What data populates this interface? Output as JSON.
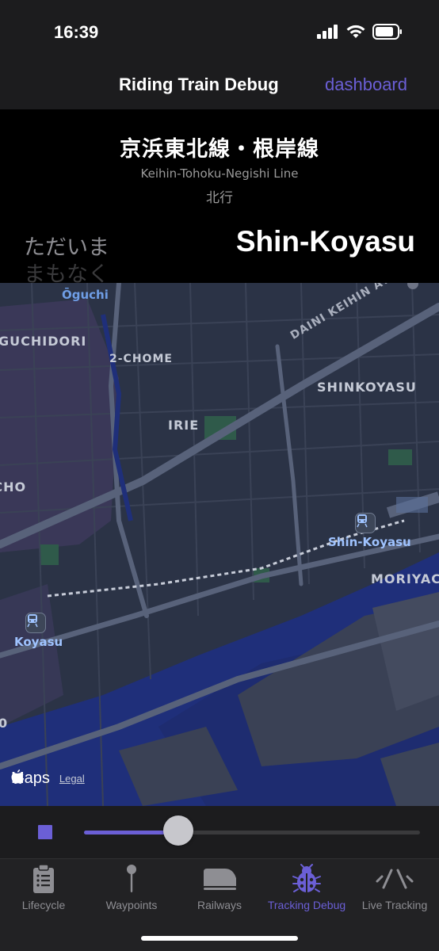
{
  "status_bar": {
    "time": "16:39",
    "icons": [
      "signal-icon",
      "wifi-icon",
      "battery-icon"
    ]
  },
  "nav": {
    "title": "Riding Train Debug",
    "action_label": "dashboard",
    "accent_color": "#6b5fd6"
  },
  "header": {
    "line_name_jp": "京浜東北線・根岸線",
    "line_name_en": "Keihin-Tohoku-Negishi Line",
    "direction": "北行",
    "state_current": "ただいま",
    "state_next": "まもなく",
    "station_name": "Shin-Koyasu"
  },
  "map": {
    "labels": {
      "oguchi": "Ōguchi",
      "guchidori": "GUCHIDORI",
      "chome": "2-CHOME",
      "irie": "IRIE",
      "cho": "ACHO",
      "avenue": "DAINI KEIHIN AVENUE",
      "shinkoyasu_area": "SHINKOYASU",
      "moriyacho": "MORIYACH",
      "zero": "0"
    },
    "stations": {
      "shin_koyasu": "Shin-Koyasu",
      "koyasu": "Koyasu"
    },
    "attribution": {
      "brand": "Maps",
      "legal": "Legal"
    }
  },
  "playback": {
    "progress_percent": 28
  },
  "tabs": [
    {
      "label": "Lifecycle",
      "icon": "clipboard-icon",
      "active": false
    },
    {
      "label": "Waypoints",
      "icon": "pin-icon",
      "active": false
    },
    {
      "label": "Railways",
      "icon": "train-icon",
      "active": false
    },
    {
      "label": "Tracking Debug",
      "icon": "ladybug-icon",
      "active": true
    },
    {
      "label": "Live Tracking",
      "icon": "live-tracking-icon",
      "active": false
    }
  ]
}
